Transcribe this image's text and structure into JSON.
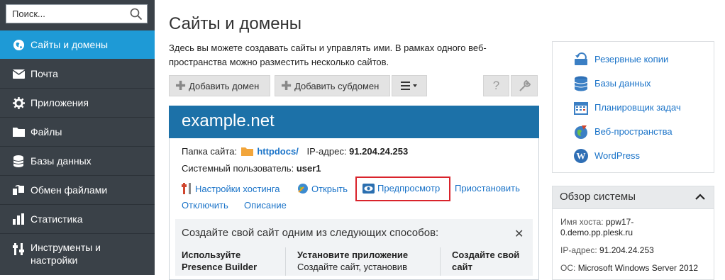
{
  "sidebar": {
    "search_placeholder": "Поиск...",
    "items": [
      {
        "label": "Сайты и домены",
        "icon": "globe-icon",
        "active": true
      },
      {
        "label": "Почта",
        "icon": "mail-icon"
      },
      {
        "label": "Приложения",
        "icon": "gear-icon"
      },
      {
        "label": "Файлы",
        "icon": "folder-icon"
      },
      {
        "label": "Базы данных",
        "icon": "database-icon"
      },
      {
        "label": "Обмен файлами",
        "icon": "share-icon"
      },
      {
        "label": "Статистика",
        "icon": "bar-chart-icon"
      },
      {
        "label_line1": "Инструменты и",
        "label_line2": "настройки",
        "icon": "tools-icon"
      }
    ]
  },
  "page": {
    "title": "Сайты и домены",
    "intro_line1": "Здесь вы можете создавать сайты и управлять ими. В рамках одного веб-",
    "intro_line2": "пространства можно разместить несколько сайтов."
  },
  "toolbar": {
    "add_domain": "Добавить домен",
    "add_subdomain": "Добавить субдомен",
    "menu_icon": "hamburger-icon",
    "help_icon": "question-icon",
    "settings_icon": "wrench-icon"
  },
  "domain": {
    "name": "example.net",
    "folder_label": "Папка сайта:",
    "folder_value": "httpdocs/",
    "ip_label": "IP-адрес:",
    "ip_value": "91.204.24.253",
    "user_label": "Системный пользователь:",
    "user_value": "user1",
    "actions": {
      "hosting": "Настройки хостинга",
      "open": "Открыть",
      "preview": "Предпросмотр",
      "suspend": "Приостановить",
      "disable": "Отключить",
      "description": "Описание"
    },
    "create": {
      "title": "Создайте свой сайт одним из следующих способов:",
      "col1_line1": "Используйте",
      "col1_line2": "Presence Builder",
      "col2_line1": "Установите приложение",
      "col2_line2": "Создайте сайт, установив",
      "col3_line1": "Создайте свой",
      "col3_line2": "сайт"
    }
  },
  "right": {
    "links": [
      {
        "label": "Резервные копии",
        "icon": "backup-icon"
      },
      {
        "label": "Базы данных",
        "icon": "database-icon"
      },
      {
        "label": "Планировщик задач",
        "icon": "calendar-icon"
      },
      {
        "label": "Веб-пространства",
        "icon": "web-globe-icon"
      },
      {
        "label": "WordPress",
        "icon": "wordpress-icon"
      }
    ],
    "overview": {
      "title": "Обзор системы",
      "host_label": "Имя хоста:",
      "host_value_line1": "ppw17-",
      "host_value_line2": "0.demo.pp.plesk.ru",
      "ip_label": "IP-адрес:",
      "ip_value": "91.204.24.253",
      "os_label": "ОС:",
      "os_value": "Microsoft Windows Server 2012"
    }
  },
  "colors": {
    "sidebar_bg": "#3a4148",
    "active_bg": "#1e9ad6",
    "card_header": "#1c71a8",
    "link": "#1a73c8",
    "highlight": "#d9232b"
  }
}
